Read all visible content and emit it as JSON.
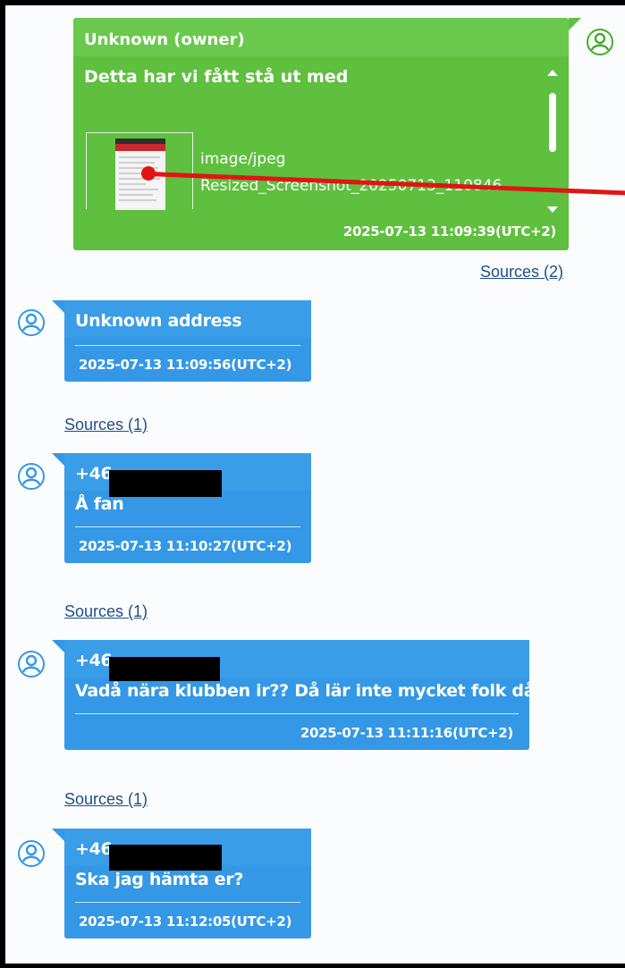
{
  "colors": {
    "incoming_bubble": "#3498e6",
    "owner_bubble": "#5fbf3f",
    "link": "#1f4f86",
    "annotation_arrow": "#e11414",
    "redaction": "#000000"
  },
  "owner_message": {
    "sender": "Unknown (owner)",
    "text": "Detta har vi fått stå ut med",
    "attachment": {
      "mime_type": "image/jpeg",
      "file_name": "Resized_Screenshot_20250713_110846..."
    },
    "timestamp": "2025-07-13 11:09:39(UTC+2)",
    "sources": "Sources (2)",
    "avatar_icon": "user-icon"
  },
  "messages": [
    {
      "sender": "Unknown address",
      "text": "",
      "timestamp": "2025-07-13 11:09:56(UTC+2)",
      "sources": "Sources (1)",
      "avatar_icon": "user-icon"
    },
    {
      "sender": "+46",
      "text": "Å fan",
      "timestamp": "2025-07-13 11:10:27(UTC+2)",
      "sources": "Sources (1)",
      "avatar_icon": "user-icon"
    },
    {
      "sender": "+46",
      "text": "Vadå nära klubben ir?? Då lär inte mycket folk då",
      "timestamp": "2025-07-13 11:11:16(UTC+2)",
      "sources": "Sources (1)",
      "avatar_icon": "user-icon"
    },
    {
      "sender": "+46",
      "text": "Ska jag hämta er?",
      "timestamp": "2025-07-13 11:12:05(UTC+2)",
      "sources": "",
      "avatar_icon": "user-icon"
    }
  ]
}
